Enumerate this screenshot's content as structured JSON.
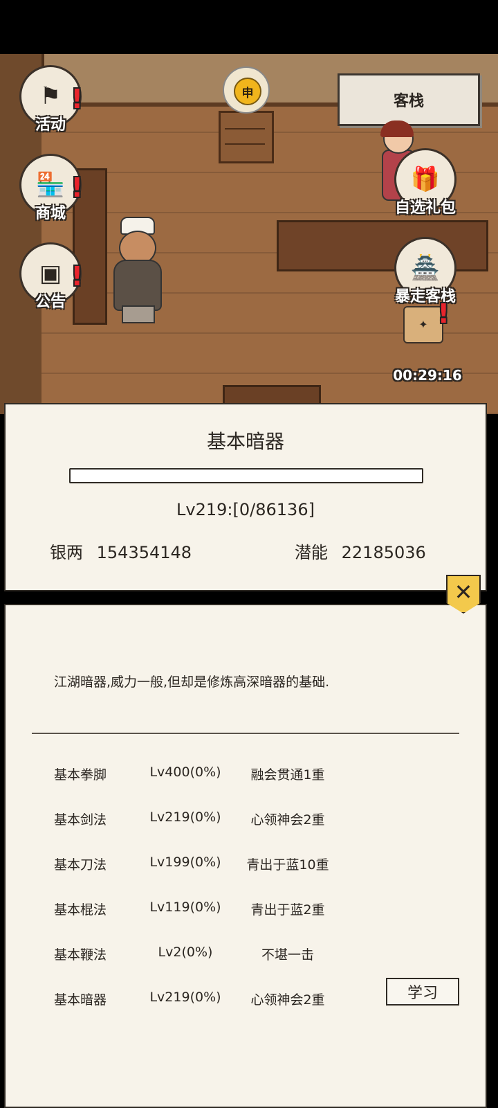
{
  "scene": {
    "inn_button": "客栈",
    "time_symbol": "申",
    "left_menu": [
      {
        "label": "活动",
        "icon": "flag-icon",
        "alert": "!"
      },
      {
        "label": "商城",
        "icon": "shop-icon",
        "alert": "!"
      },
      {
        "label": "公告",
        "icon": "notice-board-icon",
        "alert": "!"
      }
    ],
    "right_menu": [
      {
        "label": "自选礼包",
        "icon": "gift-bag-icon"
      },
      {
        "label": "暴走客栈",
        "icon": "inn-building-icon"
      }
    ],
    "promo": {
      "alert": "!",
      "timer": "00:29:16"
    }
  },
  "skill_panel": {
    "title": "基本暗器",
    "progress": 0,
    "level_text": "Lv219:[0/86136]",
    "silver_label": "银两",
    "silver_value": "154354148",
    "potential_label": "潜能",
    "potential_value": "22185036",
    "close_icon": "✕"
  },
  "skill_detail": {
    "description": "江湖暗器,威力一般,但却是修炼高深暗器的基础.",
    "skills": [
      {
        "name": "基本拳脚",
        "level": "Lv400(0%)",
        "tier": "融会贯通1重"
      },
      {
        "name": "基本剑法",
        "level": "Lv219(0%)",
        "tier": "心领神会2重"
      },
      {
        "name": "基本刀法",
        "level": "Lv199(0%)",
        "tier": "青出于蓝10重"
      },
      {
        "name": "基本棍法",
        "level": "Lv119(0%)",
        "tier": "青出于蓝2重"
      },
      {
        "name": "基本鞭法",
        "level": "Lv2(0%)",
        "tier": "不堪一击"
      },
      {
        "name": "基本暗器",
        "level": "Lv219(0%)",
        "tier": "心领神会2重"
      }
    ],
    "learn_button": "学习"
  }
}
